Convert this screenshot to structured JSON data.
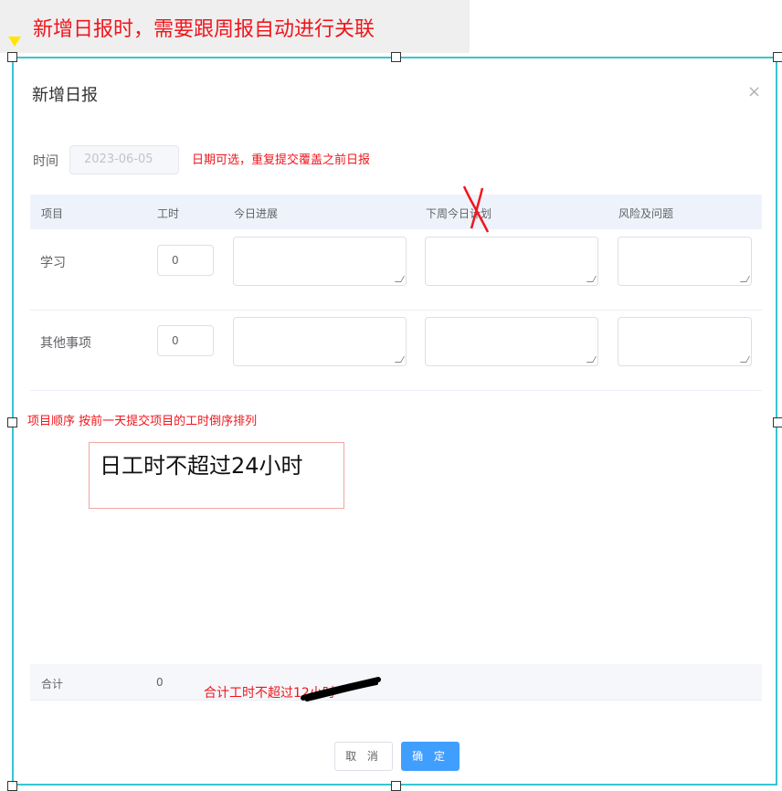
{
  "annotations": {
    "top_note": "新增日报时，需要跟周报自动进行关联",
    "date_note": "日期可选，重复提交覆盖之前日报",
    "order_note": "项目顺序 按前一天提交项目的工时倒序排列",
    "hours_limit_note": "日工时不超过24小时",
    "total_note": "合计工时不超过12小时"
  },
  "dialog": {
    "title": "新增日报",
    "close_icon": "×",
    "time_label": "时间",
    "date_value": "2023-06-05",
    "columns": [
      "项目",
      "工时",
      "今日进展",
      "下周今日计划",
      "风险及问题"
    ],
    "rows": [
      {
        "project": "学习",
        "hours": "0"
      },
      {
        "project": "其他事项",
        "hours": "0"
      }
    ],
    "footer": {
      "label": "合计",
      "value": "0"
    },
    "buttons": {
      "cancel": "取 消",
      "confirm": "确 定"
    }
  },
  "colors": {
    "annotation_red": "#f0151c",
    "selection_frame": "#35c6d2",
    "primary_button": "#409eff",
    "table_header_bg": "#eef2fb"
  }
}
